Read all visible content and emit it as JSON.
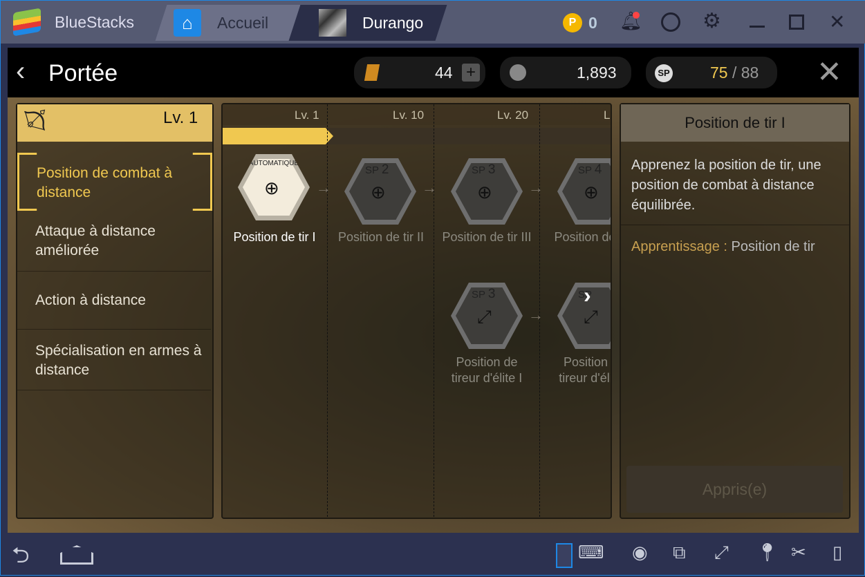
{
  "titlebar": {
    "app_name": "BlueStacks",
    "tabs": [
      {
        "label": "Accueil"
      },
      {
        "label": "Durango"
      }
    ],
    "coins": "0",
    "icons": [
      "bell-icon",
      "account-icon",
      "gear-icon",
      "minimize-icon",
      "maximize-icon",
      "close-icon"
    ]
  },
  "header": {
    "title": "Portée",
    "energy": "44",
    "gold": "1,893",
    "sp_current": "75",
    "sp_separator": "/ 88"
  },
  "left": {
    "level": "Lv. 1",
    "items": [
      "Position de combat à distance",
      "Attaque à distance améliorée",
      "Action à distance",
      "Spécialisation en armes à distance"
    ],
    "selected": 0
  },
  "tree": {
    "levels": [
      "Lv. 1",
      "Lv. 10",
      "Lv. 20",
      "L"
    ],
    "auto_label": "AUTOMATIQUE",
    "nodes": [
      {
        "label": "Position de tir I",
        "cost": "",
        "sp": ""
      },
      {
        "label": "Position de tir II",
        "sp": "SP",
        "cost": "2"
      },
      {
        "label": "Position de tir III",
        "sp": "SP",
        "cost": "3"
      },
      {
        "label": "Position de IV",
        "sp": "SP",
        "cost": "4"
      },
      {
        "label": "Position de tireur d'élite I",
        "sp": "SP",
        "cost": "3"
      },
      {
        "label": "Position tireur d'éli",
        "sp": "SP",
        "cost": ""
      }
    ]
  },
  "detail": {
    "title": "Position de tir I",
    "description": "Apprenez la position de tir, une position de combat à distance équilibrée.",
    "learn_label": "Apprentissage :",
    "learn_value": "Position de tir",
    "button": "Appris(e)"
  },
  "colors": {
    "accent": "#f0c850",
    "titlebar": "#555a72",
    "bottombar": "#2c3150"
  }
}
